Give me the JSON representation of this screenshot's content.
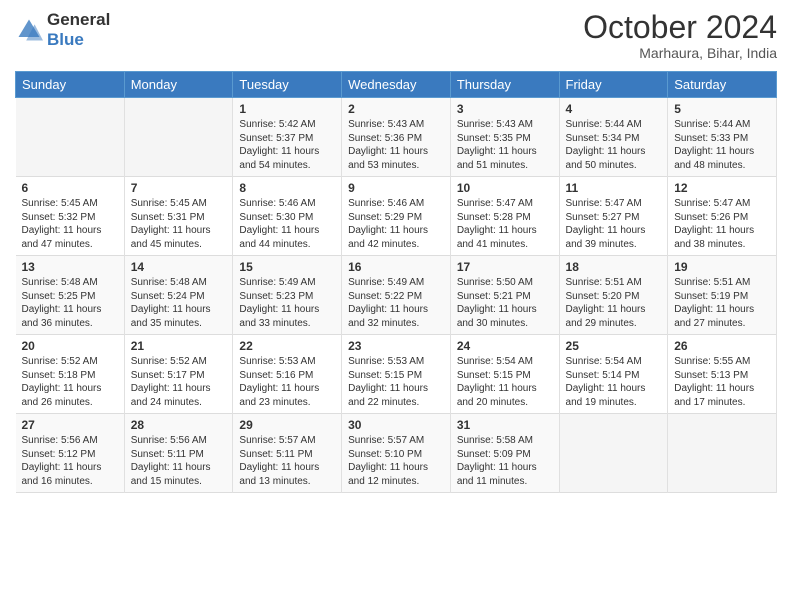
{
  "logo": {
    "line1": "General",
    "line2": "Blue"
  },
  "header": {
    "month": "October 2024",
    "location": "Marhaura, Bihar, India"
  },
  "weekdays": [
    "Sunday",
    "Monday",
    "Tuesday",
    "Wednesday",
    "Thursday",
    "Friday",
    "Saturday"
  ],
  "weeks": [
    [
      {
        "day": "",
        "sunrise": "",
        "sunset": "",
        "daylight": ""
      },
      {
        "day": "",
        "sunrise": "",
        "sunset": "",
        "daylight": ""
      },
      {
        "day": "1",
        "sunrise": "Sunrise: 5:42 AM",
        "sunset": "Sunset: 5:37 PM",
        "daylight": "Daylight: 11 hours and 54 minutes."
      },
      {
        "day": "2",
        "sunrise": "Sunrise: 5:43 AM",
        "sunset": "Sunset: 5:36 PM",
        "daylight": "Daylight: 11 hours and 53 minutes."
      },
      {
        "day": "3",
        "sunrise": "Sunrise: 5:43 AM",
        "sunset": "Sunset: 5:35 PM",
        "daylight": "Daylight: 11 hours and 51 minutes."
      },
      {
        "day": "4",
        "sunrise": "Sunrise: 5:44 AM",
        "sunset": "Sunset: 5:34 PM",
        "daylight": "Daylight: 11 hours and 50 minutes."
      },
      {
        "day": "5",
        "sunrise": "Sunrise: 5:44 AM",
        "sunset": "Sunset: 5:33 PM",
        "daylight": "Daylight: 11 hours and 48 minutes."
      }
    ],
    [
      {
        "day": "6",
        "sunrise": "Sunrise: 5:45 AM",
        "sunset": "Sunset: 5:32 PM",
        "daylight": "Daylight: 11 hours and 47 minutes."
      },
      {
        "day": "7",
        "sunrise": "Sunrise: 5:45 AM",
        "sunset": "Sunset: 5:31 PM",
        "daylight": "Daylight: 11 hours and 45 minutes."
      },
      {
        "day": "8",
        "sunrise": "Sunrise: 5:46 AM",
        "sunset": "Sunset: 5:30 PM",
        "daylight": "Daylight: 11 hours and 44 minutes."
      },
      {
        "day": "9",
        "sunrise": "Sunrise: 5:46 AM",
        "sunset": "Sunset: 5:29 PM",
        "daylight": "Daylight: 11 hours and 42 minutes."
      },
      {
        "day": "10",
        "sunrise": "Sunrise: 5:47 AM",
        "sunset": "Sunset: 5:28 PM",
        "daylight": "Daylight: 11 hours and 41 minutes."
      },
      {
        "day": "11",
        "sunrise": "Sunrise: 5:47 AM",
        "sunset": "Sunset: 5:27 PM",
        "daylight": "Daylight: 11 hours and 39 minutes."
      },
      {
        "day": "12",
        "sunrise": "Sunrise: 5:47 AM",
        "sunset": "Sunset: 5:26 PM",
        "daylight": "Daylight: 11 hours and 38 minutes."
      }
    ],
    [
      {
        "day": "13",
        "sunrise": "Sunrise: 5:48 AM",
        "sunset": "Sunset: 5:25 PM",
        "daylight": "Daylight: 11 hours and 36 minutes."
      },
      {
        "day": "14",
        "sunrise": "Sunrise: 5:48 AM",
        "sunset": "Sunset: 5:24 PM",
        "daylight": "Daylight: 11 hours and 35 minutes."
      },
      {
        "day": "15",
        "sunrise": "Sunrise: 5:49 AM",
        "sunset": "Sunset: 5:23 PM",
        "daylight": "Daylight: 11 hours and 33 minutes."
      },
      {
        "day": "16",
        "sunrise": "Sunrise: 5:49 AM",
        "sunset": "Sunset: 5:22 PM",
        "daylight": "Daylight: 11 hours and 32 minutes."
      },
      {
        "day": "17",
        "sunrise": "Sunrise: 5:50 AM",
        "sunset": "Sunset: 5:21 PM",
        "daylight": "Daylight: 11 hours and 30 minutes."
      },
      {
        "day": "18",
        "sunrise": "Sunrise: 5:51 AM",
        "sunset": "Sunset: 5:20 PM",
        "daylight": "Daylight: 11 hours and 29 minutes."
      },
      {
        "day": "19",
        "sunrise": "Sunrise: 5:51 AM",
        "sunset": "Sunset: 5:19 PM",
        "daylight": "Daylight: 11 hours and 27 minutes."
      }
    ],
    [
      {
        "day": "20",
        "sunrise": "Sunrise: 5:52 AM",
        "sunset": "Sunset: 5:18 PM",
        "daylight": "Daylight: 11 hours and 26 minutes."
      },
      {
        "day": "21",
        "sunrise": "Sunrise: 5:52 AM",
        "sunset": "Sunset: 5:17 PM",
        "daylight": "Daylight: 11 hours and 24 minutes."
      },
      {
        "day": "22",
        "sunrise": "Sunrise: 5:53 AM",
        "sunset": "Sunset: 5:16 PM",
        "daylight": "Daylight: 11 hours and 23 minutes."
      },
      {
        "day": "23",
        "sunrise": "Sunrise: 5:53 AM",
        "sunset": "Sunset: 5:15 PM",
        "daylight": "Daylight: 11 hours and 22 minutes."
      },
      {
        "day": "24",
        "sunrise": "Sunrise: 5:54 AM",
        "sunset": "Sunset: 5:15 PM",
        "daylight": "Daylight: 11 hours and 20 minutes."
      },
      {
        "day": "25",
        "sunrise": "Sunrise: 5:54 AM",
        "sunset": "Sunset: 5:14 PM",
        "daylight": "Daylight: 11 hours and 19 minutes."
      },
      {
        "day": "26",
        "sunrise": "Sunrise: 5:55 AM",
        "sunset": "Sunset: 5:13 PM",
        "daylight": "Daylight: 11 hours and 17 minutes."
      }
    ],
    [
      {
        "day": "27",
        "sunrise": "Sunrise: 5:56 AM",
        "sunset": "Sunset: 5:12 PM",
        "daylight": "Daylight: 11 hours and 16 minutes."
      },
      {
        "day": "28",
        "sunrise": "Sunrise: 5:56 AM",
        "sunset": "Sunset: 5:11 PM",
        "daylight": "Daylight: 11 hours and 15 minutes."
      },
      {
        "day": "29",
        "sunrise": "Sunrise: 5:57 AM",
        "sunset": "Sunset: 5:11 PM",
        "daylight": "Daylight: 11 hours and 13 minutes."
      },
      {
        "day": "30",
        "sunrise": "Sunrise: 5:57 AM",
        "sunset": "Sunset: 5:10 PM",
        "daylight": "Daylight: 11 hours and 12 minutes."
      },
      {
        "day": "31",
        "sunrise": "Sunrise: 5:58 AM",
        "sunset": "Sunset: 5:09 PM",
        "daylight": "Daylight: 11 hours and 11 minutes."
      },
      {
        "day": "",
        "sunrise": "",
        "sunset": "",
        "daylight": ""
      },
      {
        "day": "",
        "sunrise": "",
        "sunset": "",
        "daylight": ""
      }
    ]
  ]
}
